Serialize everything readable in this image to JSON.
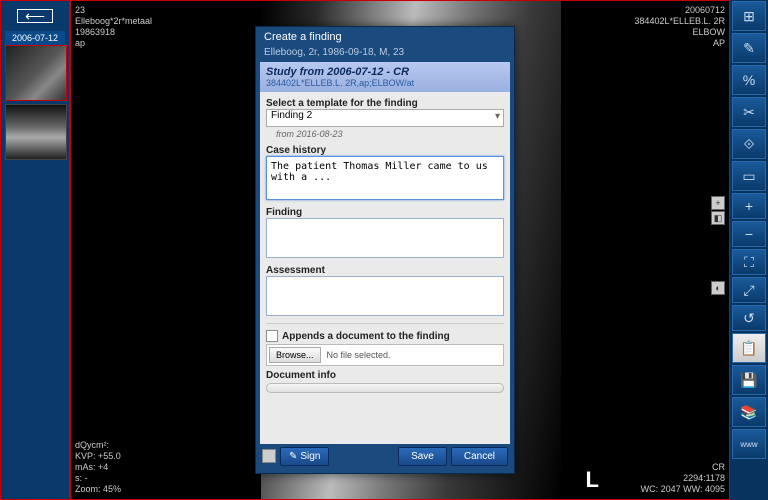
{
  "left": {
    "thumb_date": "2006-07-12"
  },
  "viewer": {
    "tl": {
      "l1": "23",
      "l2": "Elleboog*2r*metaal",
      "l3": "19863918",
      "l4": "ap"
    },
    "tr": {
      "l1": "20060712",
      "l2": "384402L*ELLEB.L. 2R",
      "l3": "ELBOW",
      "l4": "AP"
    },
    "bl": {
      "l1": "dQycm²:",
      "l2": "KVP: +55.0",
      "l3": "mAs: +4",
      "l4": "s: -",
      "l5": "Zoom: 45%"
    },
    "br": {
      "l1": "CR",
      "l2": "2294:1178",
      "l3": "WC: 2047 WW: 4095"
    },
    "marker": "L"
  },
  "tools": [
    "⊞",
    "✎",
    "%",
    "✂",
    "⟐",
    "▭",
    "+",
    "−",
    "⛶",
    "⤢",
    "↺",
    "📋",
    "💾",
    "📚",
    "www"
  ],
  "dialog": {
    "title": "Create a finding",
    "patient": "Elleboog, 2r, 1986-09-18, M, 23",
    "study_title": "Study from 2006-07-12 - CR",
    "study_sub": "384402L*ELLEB.L. 2R,ap;ELBOW/at",
    "template_lbl": "Select a template for the finding",
    "template_val": "Finding 2",
    "template_date": "from 2016-08-23",
    "history_lbl": "Case history",
    "history_val": "The patient Thomas Miller came to us with a ...",
    "finding_lbl": "Finding",
    "assess_lbl": "Assessment",
    "attach_lbl": "Appends a document to the finding",
    "browse": "Browse...",
    "nofile": "No file selected.",
    "docinfo_lbl": "Document info",
    "sign": "Sign",
    "save": "Save",
    "cancel": "Cancel"
  }
}
